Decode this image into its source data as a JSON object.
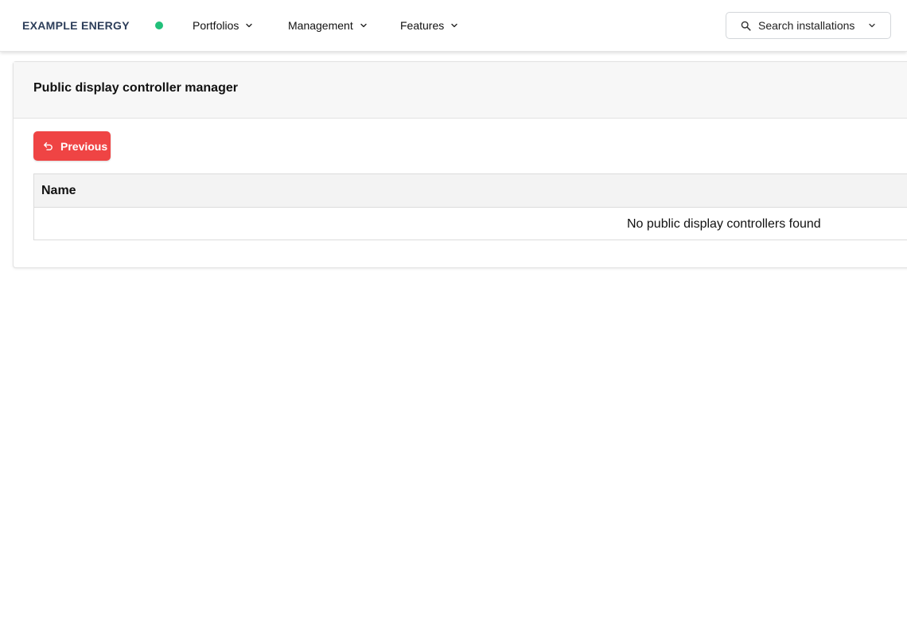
{
  "brand": {
    "name": "EXAMPLE ENERGY",
    "status_color": "#22c07a"
  },
  "nav": {
    "items": [
      {
        "label": "Portfolios"
      },
      {
        "label": "Management"
      },
      {
        "label": "Features"
      }
    ]
  },
  "search": {
    "label": "Search installations"
  },
  "page": {
    "title": "Public display controller manager",
    "previous_label": "Previous",
    "table": {
      "columns": [
        "Name"
      ],
      "empty_message": "No public display controllers found"
    }
  },
  "colors": {
    "accent": "#ef4444",
    "brand_text": "#2d3e5a"
  }
}
